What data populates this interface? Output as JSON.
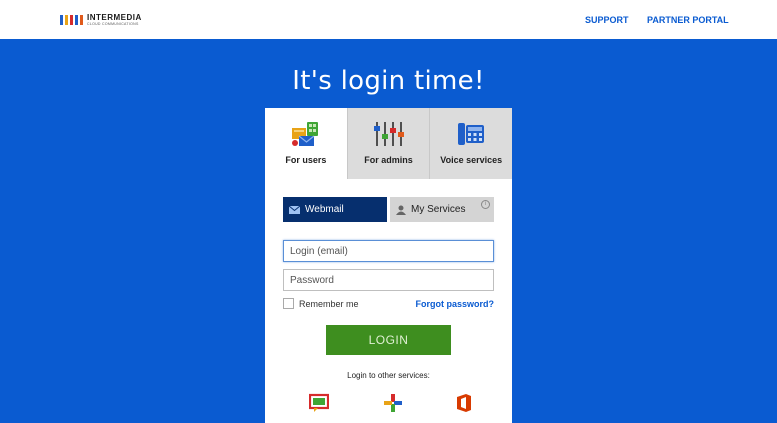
{
  "header": {
    "logo": {
      "name": "INTERMEDIA",
      "tagline": "CLOUD COMMUNICATIONS",
      "bar_colors": [
        "#1f5fc9",
        "#e8a317",
        "#d62b2b",
        "#1f5fc9",
        "#e05a1b"
      ]
    },
    "nav": {
      "support": "SUPPORT",
      "partner_portal": "PARTNER PORTAL"
    }
  },
  "hero": {
    "title": "It's login time!"
  },
  "tabs": [
    {
      "label": "For users",
      "icon": "users-icon",
      "active": true
    },
    {
      "label": "For admins",
      "icon": "sliders-icon",
      "active": false
    },
    {
      "label": "Voice services",
      "icon": "phone-icon",
      "active": false
    }
  ],
  "subtabs": {
    "webmail": "Webmail",
    "my_services": "My Services"
  },
  "form": {
    "login_placeholder": "Login (email)",
    "password_placeholder": "Password",
    "remember_me": "Remember me",
    "forgot_password": "Forgot password?",
    "login_button": "LOGIN"
  },
  "other_services": {
    "label": "Login to other services:",
    "icons": [
      "video-chat-icon",
      "plus-sync-icon",
      "office-icon"
    ]
  },
  "colors": {
    "brand_blue": "#0a5bd1",
    "dark_blue": "#062f6e",
    "green": "#3e8e1f"
  }
}
